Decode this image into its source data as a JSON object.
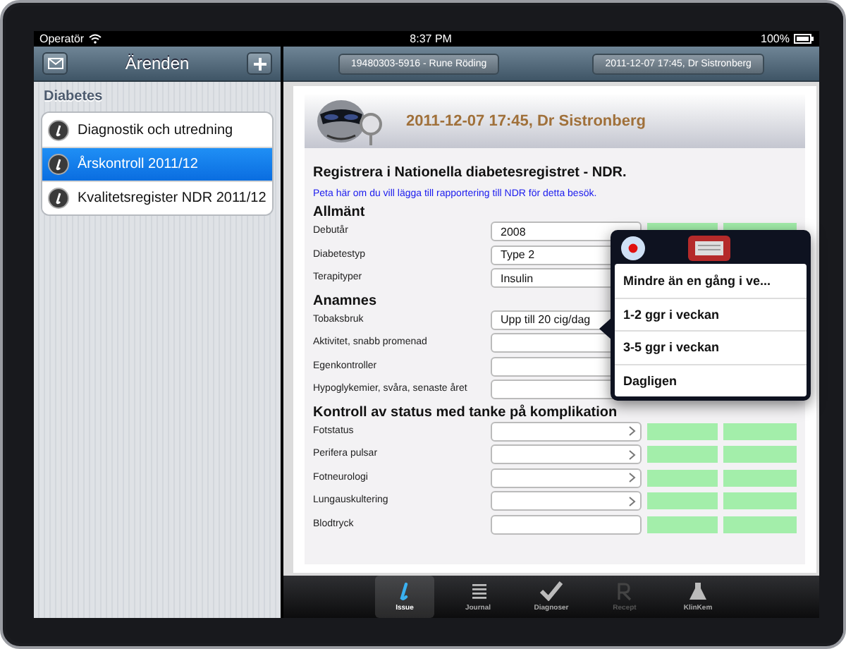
{
  "status_bar": {
    "carrier": "Operatör",
    "time": "8:37 PM",
    "battery": "100%"
  },
  "sidebar": {
    "title": "Ärenden",
    "section": "Diabetes",
    "items": [
      {
        "label": "Diagnostik och utredning",
        "selected": false
      },
      {
        "label": "Årskontroll 2011/12",
        "selected": true
      },
      {
        "label": "Kvalitetsregister NDR 2011/12",
        "selected": false
      }
    ]
  },
  "toolbar": {
    "buttons": [
      "19480303-5916 - Rune Röding",
      "2011-12-07 17:45, Dr Sistronberg"
    ]
  },
  "document": {
    "header": "2011-12-07 17:45, Dr Sistronberg",
    "title": "Registrera i Nationella diabetesregistret - NDR.",
    "link": "Peta här om du vill lägga till rapportering till NDR för detta besök.",
    "sections": [
      {
        "title": "Allmänt",
        "rows": [
          {
            "label": "Debutår",
            "value": "2008",
            "chevron": false
          },
          {
            "label": "Diabetestyp",
            "value": "Type 2"
          },
          {
            "label": "Terapityper",
            "value": "Insulin"
          }
        ]
      },
      {
        "title": "Anamnes",
        "rows": [
          {
            "label": "Tobaksbruk",
            "value": "Upp till 20 cig/dag"
          },
          {
            "label": "Aktivitet, snabb promenad"
          },
          {
            "label": "Egenkontroller"
          },
          {
            "label": "Hypoglykemier, svåra, senaste året"
          }
        ]
      },
      {
        "title": "Kontroll av status med tanke på komplikation",
        "rows": [
          {
            "label": "Fotstatus",
            "chevron": true
          },
          {
            "label": "Perifera pulsar",
            "chevron": true
          },
          {
            "label": "Fotneurologi",
            "chevron": true
          },
          {
            "label": "Lungauskultering",
            "chevron": true
          },
          {
            "label": "Blodtryck",
            "chevron": false
          }
        ]
      }
    ]
  },
  "popover": {
    "options": [
      "Mindre än en gång i ve...",
      "1-2 ggr i veckan",
      "3-5 ggr i veckan",
      "Dagligen"
    ]
  },
  "tab_bar": [
    {
      "label": "Issue",
      "kind": "issue",
      "selected": true,
      "disabled": false
    },
    {
      "label": "Journal",
      "kind": "journal",
      "selected": false,
      "disabled": false
    },
    {
      "label": "Diagnoser",
      "kind": "check",
      "selected": false,
      "disabled": false
    },
    {
      "label": "Recept",
      "kind": "rx",
      "selected": false,
      "disabled": true
    },
    {
      "label": "KlinKem",
      "kind": "flask",
      "selected": false,
      "disabled": false
    }
  ]
}
